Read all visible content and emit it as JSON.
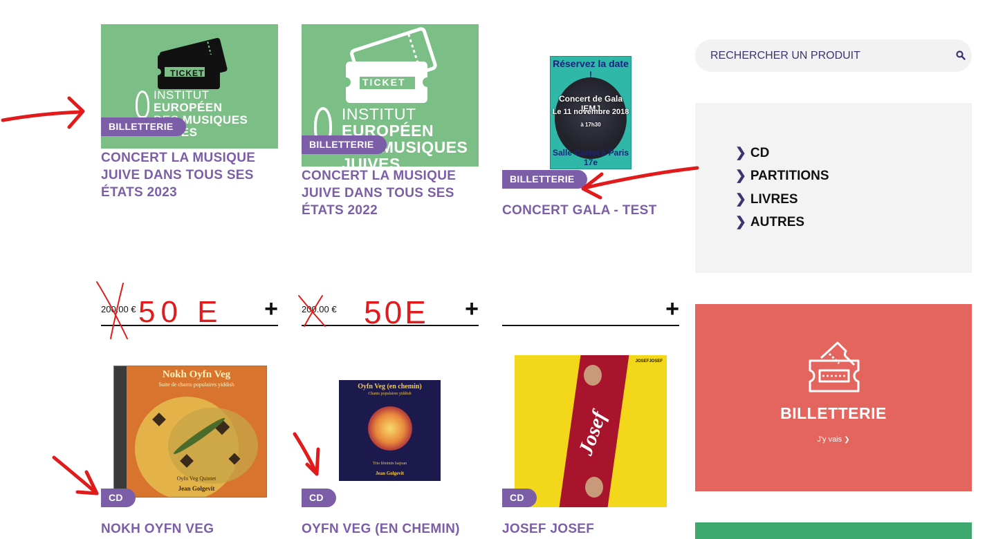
{
  "products": [
    {
      "badge": "BILLETTERIE",
      "title": "CONCERT LA MUSIQUE JUIVE DANS TOUS SES ÉTATS 2023",
      "price": "200.00 €",
      "add": "+"
    },
    {
      "badge": "BILLETTERIE",
      "title": "CONCERT LA MUSIQUE JUIVE DANS TOUS SES ÉTATS 2022",
      "price": "200.00 €",
      "add": "+"
    },
    {
      "badge": "BILLETTERIE",
      "title": "CONCERT GALA - TEST",
      "price": "",
      "add": "+"
    },
    {
      "badge": "CD",
      "title": "NOKH OYFN VEG"
    },
    {
      "badge": "CD",
      "title": "OYFN VEG (EN CHEMIN)"
    },
    {
      "badge": "CD",
      "title": "JOSEF JOSEF"
    }
  ],
  "images": {
    "ticket_word": "TICKET",
    "logo_line1a": "INSTITUT ",
    "logo_line1b": "EUROPÉEN",
    "logo_line2a": "DES ",
    "logo_line2b": "MUSIQUES",
    "logo_line3": "JUIVES",
    "poster_top": "Réservez la date !",
    "poster_line1": "Concert de Gala IEMJ",
    "poster_line2": "Le 11 novembre 2018",
    "poster_line3": "à 17h30",
    "poster_bottom": "Salle Cortot à Paris 17e",
    "cd1_title": "Nokh Oyfn Veg",
    "cd1_sub": "Suite de chants populaires yiddish",
    "cd1_artist": "Oyfn Veg Quintet",
    "cd1_director": "Jean Golgevit",
    "cd2_title": "Oyfn Veg (en chemin)",
    "cd2_sub": "Chants populaires yiddish",
    "cd2_artist": "Trio féminin Isajoan",
    "cd2_director": "Jean Golgevit",
    "cd3_label": "JOSEFJOSEF",
    "cd3_art": "Josef"
  },
  "annotations": {
    "price1": "50 E",
    "price2": "50E"
  },
  "sidebar": {
    "search_placeholder": "RECHERCHER UN PRODUIT",
    "categories": [
      "CD",
      "PARTITIONS",
      "LIVRES",
      "AUTRES"
    ],
    "promo_title": "BILLETTERIE",
    "promo_link": "J'y vais"
  },
  "colors": {
    "accent": "#7b5ea7",
    "ticket_green": "#7bbf86",
    "promo_red": "#e3655e",
    "annotation_red": "#e11b1b"
  }
}
